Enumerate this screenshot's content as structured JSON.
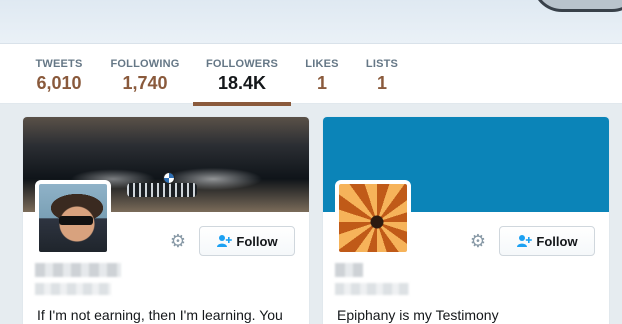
{
  "stats": [
    {
      "label": "TWEETS",
      "value": "6,010",
      "active": false
    },
    {
      "label": "FOLLOWING",
      "value": "1,740",
      "active": false
    },
    {
      "label": "FOLLOWERS",
      "value": "18.4K",
      "active": true
    },
    {
      "label": "LIKES",
      "value": "1",
      "active": false
    },
    {
      "label": "LISTS",
      "value": "1",
      "active": false
    }
  ],
  "cards": [
    {
      "follow_label": "Follow",
      "bio": "If I'm not earning, then I'm learning. You"
    },
    {
      "follow_label": "Follow",
      "bio": "Epiphany is my Testimony"
    }
  ],
  "icons": {
    "settings": "gear-icon",
    "follow": "add-user-icon"
  },
  "colors": {
    "accent": "#8a5a3c",
    "banner_blue": "#0b84b8",
    "follow_icon": "#1da1f2"
  }
}
